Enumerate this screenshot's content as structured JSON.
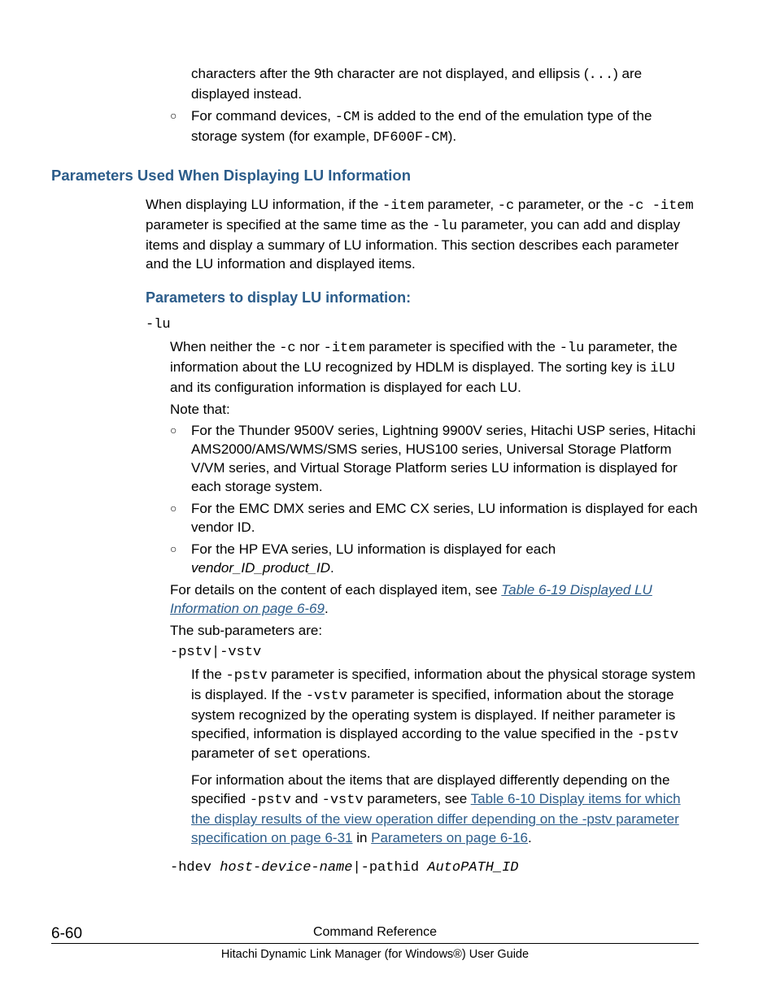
{
  "topBullets": [
    {
      "pre": "characters after the 9th character are not displayed, and ellipsis (",
      "code1": "...",
      "post": ") are displayed instead."
    },
    {
      "text1": "For command devices, ",
      "code1": "-CM",
      "text2": " is added to the end of the emulation type of the storage system (for example, ",
      "code2": "DF600F-CM",
      "text3": ")."
    }
  ],
  "h1": "Parameters Used When Displaying LU Information",
  "intro": {
    "p1a": "When displaying LU information, if the ",
    "c1": "-item",
    "p1b": " parameter, ",
    "c2": "-c",
    "p1c": " parameter, or the ",
    "c3": "-c -item",
    "p1d": " parameter is specified at the same time as the ",
    "c4": "-lu",
    "p1e": " parameter, you can add and display items and display a summary of LU information. This section describes each parameter and the LU information and displayed items."
  },
  "h2": "Parameters to display LU information:",
  "luCode": "-lu",
  "luDesc": {
    "a": "When neither the ",
    "c1": "-c",
    "b": " nor ",
    "c2": "-item",
    "c": " parameter is specified with the ",
    "c3": "-lu",
    "d": " parameter, the information about the LU recognized by HDLM is displayed. The sorting key is ",
    "c4": "iLU",
    "e": " and its configuration information is displayed for each LU."
  },
  "noteThat": "Note that:",
  "luBullets": [
    "For the Thunder 9500V series, Lightning 9900V series, Hitachi USP series, Hitachi AMS2000/AMS/WMS/SMS series, HUS100 series, Universal Storage Platform V/VM series, and Virtual Storage Platform series LU information is displayed for each storage system.",
    "For the EMC DMX series and EMC CX series, LU information is displayed for each vendor ID."
  ],
  "luBullet3": {
    "a": "For the HP EVA series, LU information is displayed for each ",
    "i": "vendor_ID_product_ID",
    "b": "."
  },
  "detailsLine": {
    "a": "For details on the content of each displayed item, see ",
    "link": "Table 6-19 Displayed LU Information on page 6-69",
    "b": "."
  },
  "subParamsLine": "The sub-parameters are:",
  "pstvCode": "-pstv|-vstv",
  "pstvDesc": {
    "a": "If the ",
    "c1": "-pstv",
    "b": " parameter is specified, information about the physical storage system is displayed. If the ",
    "c2": "-vstv",
    "c": " parameter is specified, information about the storage system recognized by the operating system is displayed. If neither parameter is specified, information is displayed according to the value specified in the ",
    "c3": "-pstv",
    "d": " parameter of ",
    "c4": "set",
    "e": " operations."
  },
  "pstvInfo": {
    "a": "For information about the items that are displayed differently depending on the specified ",
    "c1": "-pstv",
    "b": " and ",
    "c2": "-vstv",
    "c": " parameters, see ",
    "link1": "Table 6-10 Display items for which the display results of the view operation differ depending on the -pstv parameter specification on page 6-31",
    "d": " in ",
    "link2": "Parameters on page 6-16",
    "e": "."
  },
  "hdev": {
    "c1": "-hdev ",
    "i1": "host-device-name",
    "c2": "|-pathid ",
    "i2": "AutoPATH_ID"
  },
  "footer": {
    "page": "6-60",
    "title": "Command Reference",
    "sub": "Hitachi Dynamic Link Manager (for Windows®) User Guide"
  }
}
